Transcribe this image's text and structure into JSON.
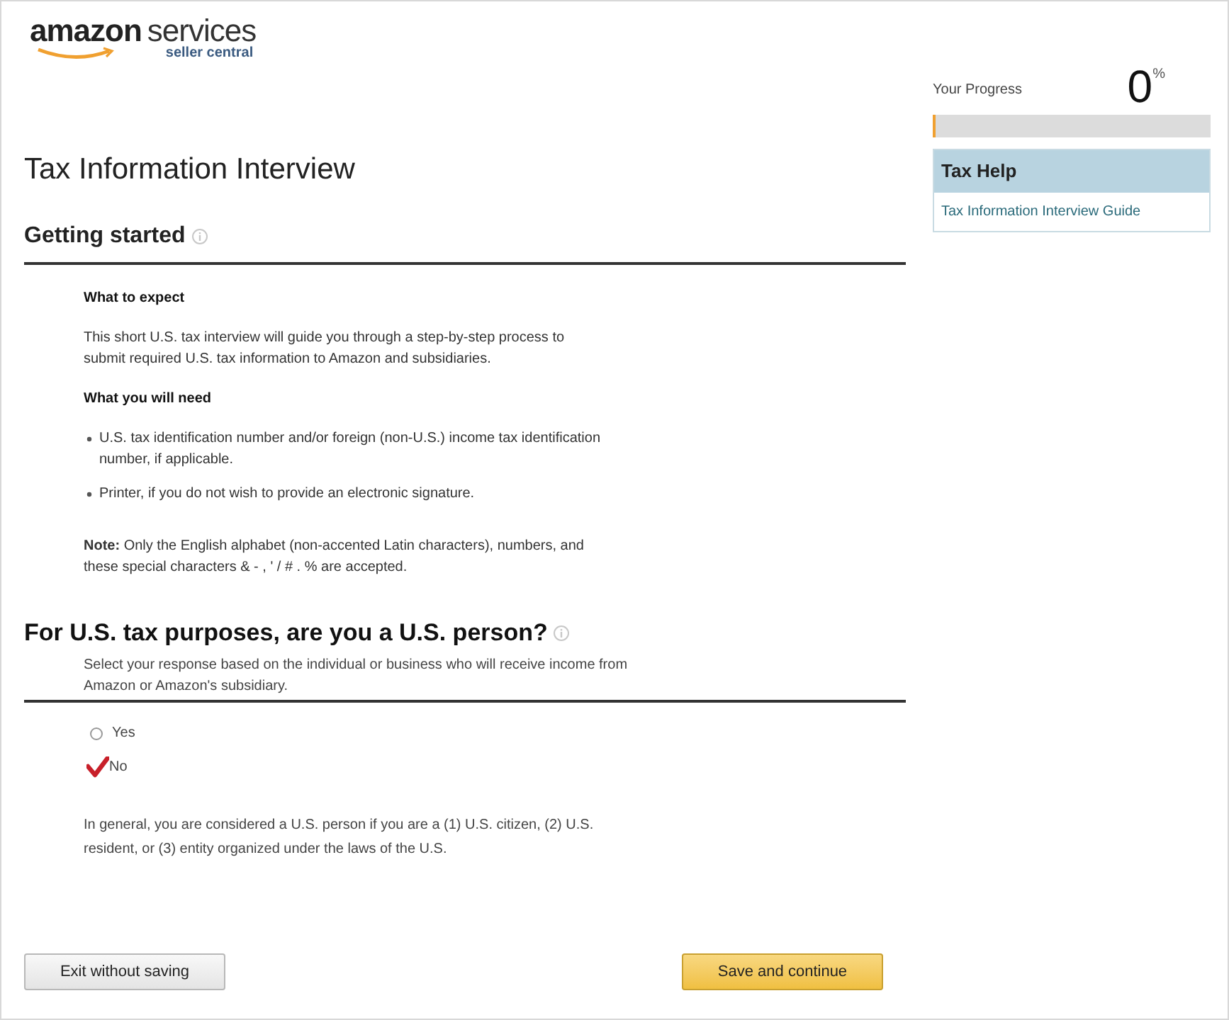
{
  "logo": {
    "brand": "amazon",
    "product": "services",
    "subtitle": "seller central"
  },
  "title": "Tax Information Interview",
  "progress": {
    "label": "Your Progress",
    "value": "0",
    "unit": "%",
    "level": 0.01
  },
  "help": {
    "title": "Tax Help",
    "links": [
      "Tax Information Interview Guide"
    ]
  },
  "getting_started": {
    "heading": "Getting started",
    "sections": [
      {
        "kind": "subheading",
        "text": "What to expect"
      },
      {
        "kind": "paragraph",
        "text": "This short U.S. tax interview will guide you through a step-by-step process to submit required U.S. tax information to Amazon and subsidiaries."
      },
      {
        "kind": "subheading",
        "text": "What you will need"
      },
      {
        "kind": "bullets",
        "items": [
          "U.S. tax identification number and/or foreign (non-U.S.) income tax identification number, if applicable.",
          "Printer, if you do not wish to provide an electronic signature."
        ]
      },
      {
        "kind": "paragraph",
        "text": "**Note:** Only the English alphabet (non-accented Latin characters), numbers, and these special characters & - , ' / # . % are accepted."
      }
    ]
  },
  "question": {
    "heading": "For U.S. tax purposes, are you a U.S. person?",
    "hint": "Select your response based on the individual or business who will receive income from Amazon or Amazon's subsidiary.",
    "options": [
      {
        "label": "Yes",
        "selected": false
      },
      {
        "label": "No",
        "selected": true
      }
    ],
    "note": "In general, you are considered a U.S. person if you are a (1) U.S. citizen, (2) U.S. resident, or (3) entity organized under the laws of the U.S."
  },
  "buttons": [
    {
      "kind": "secondary",
      "label": "Exit without saving"
    },
    {
      "kind": "primary",
      "label": "Save and continue"
    }
  ]
}
